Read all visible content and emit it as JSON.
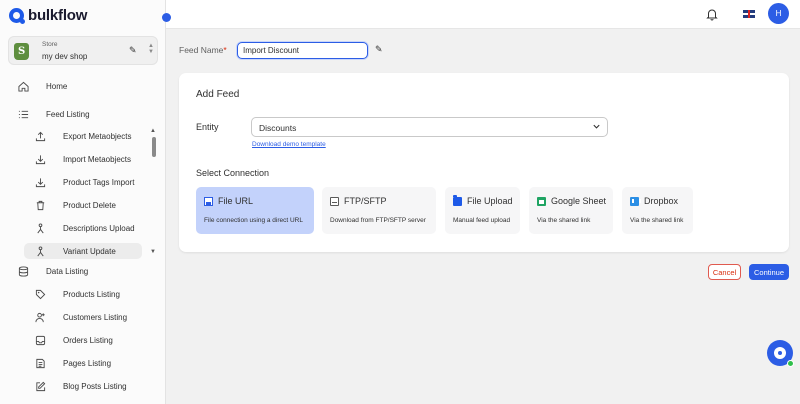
{
  "brand": {
    "name": "bulkflow",
    "accent": "#2c5de5"
  },
  "store": {
    "label": "Store",
    "name": "my dev shop"
  },
  "sidebar": {
    "home": "Home",
    "feed_listing": "Feed Listing",
    "feed_items": [
      "Export Metaobjects",
      "Import Metaobjects",
      "Product Tags Import",
      "Product Delete",
      "Descriptions Upload",
      "Variant Update"
    ],
    "data_listing": "Data Listing",
    "data_items": [
      "Products Listing",
      "Customers Listing",
      "Orders Listing",
      "Pages Listing",
      "Blog Posts Listing"
    ]
  },
  "header": {
    "avatar_initial": "H"
  },
  "feed_name": {
    "label": "Feed Name",
    "required_mark": "*",
    "value": "Import Discount"
  },
  "card": {
    "title": "Add Feed",
    "entity_label": "Entity",
    "entity_value": "Discounts",
    "demo_link": "Download demo template",
    "connection_title": "Select Connection",
    "connections": [
      {
        "name": "File URL",
        "desc": "File connection using a direct URL",
        "selected": true
      },
      {
        "name": "FTP/SFTP",
        "desc": "Download from FTP/SFTP server"
      },
      {
        "name": "File Upload",
        "desc": "Manual feed upload"
      },
      {
        "name": "Google Sheet",
        "desc": "Via the shared link"
      },
      {
        "name": "Dropbox",
        "desc": "Via the shared link"
      }
    ]
  },
  "actions": {
    "cancel": "Cancel",
    "continue": "Continue"
  }
}
